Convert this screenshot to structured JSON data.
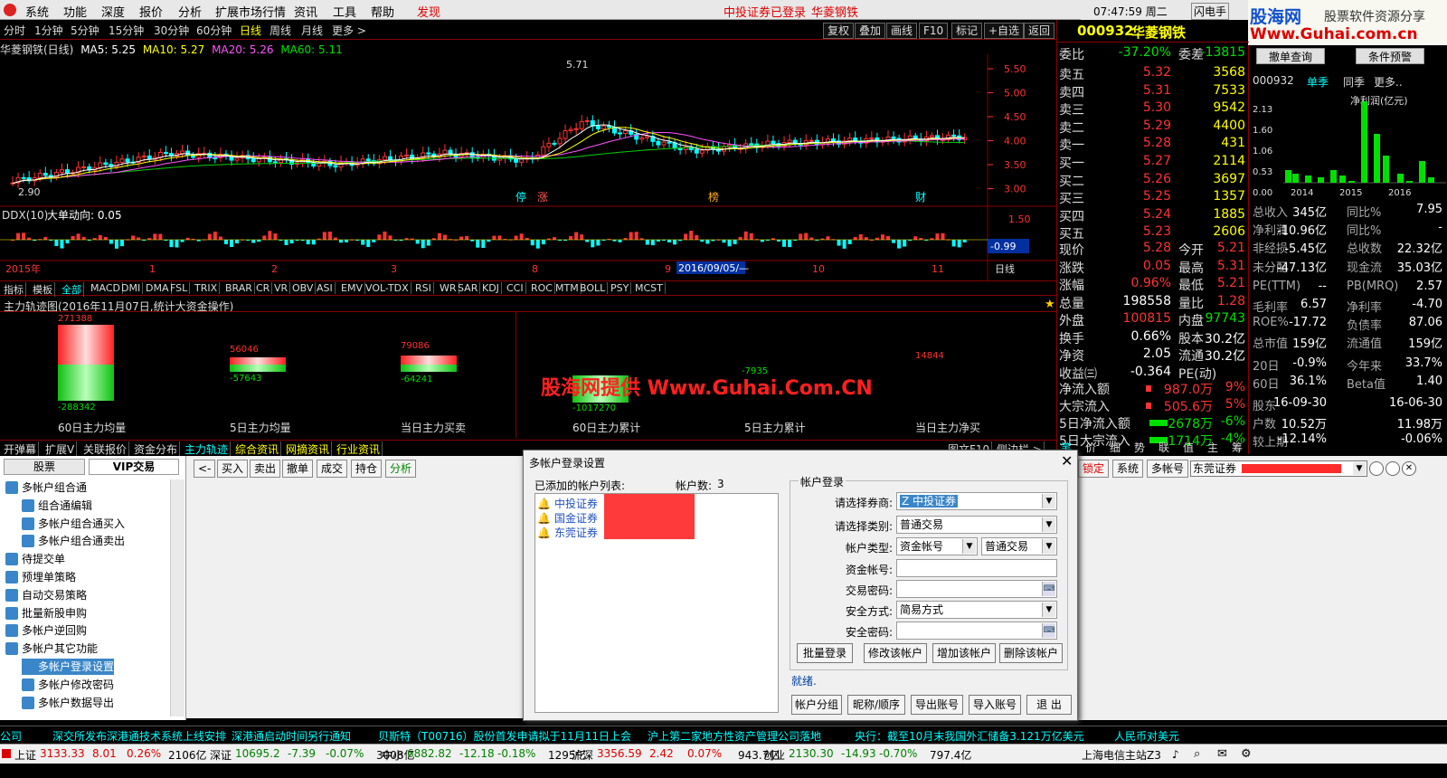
{
  "menu": {
    "items": [
      "系统",
      "功能",
      "深度",
      "报价",
      "分析",
      "扩展市场行情",
      "资讯",
      "工具",
      "帮助",
      "发现"
    ],
    "status_text": "中投证券已登录",
    "stock_link": "华菱钢铁",
    "clock": "07:47:59 周二",
    "shandian": "闪电手"
  },
  "watermark": {
    "top": "股海网",
    "top2": "股票软件资源分享",
    "url": "Www.Guhai.com.cn",
    "center": "股海网提供 Www.Guhai.Com.CN"
  },
  "periods": [
    "分时",
    "1分钟",
    "5分钟",
    "15分钟",
    "30分钟",
    "60分钟",
    "日线",
    "周线",
    "月线",
    "更多 >"
  ],
  "chart_tools": [
    "复权",
    "叠加",
    "画线",
    "F10",
    "标记",
    "+自选",
    "返回"
  ],
  "chart_title": {
    "name": "华菱钢铁(日线)",
    "ma5": "MA5: 5.25",
    "ma10": "MA10: 5.27",
    "ma20": "MA20: 5.26",
    "ma60": "MA60: 5.11"
  },
  "price_axis": [
    "5.50",
    "5.00",
    "4.50",
    "4.00",
    "3.50",
    "3.00"
  ],
  "price_labels": {
    "high": "5.71",
    "low": "2.90"
  },
  "events": [
    "停",
    "涨",
    "榜",
    "财"
  ],
  "ddx": {
    "title": "DDX(10)",
    "desc": "大单动向: 0.05",
    "axis": [
      "1.50"
    ],
    "value": "-0.99"
  },
  "time_axis": {
    "year": "2015年",
    "marks": [
      "1",
      "2",
      "3",
      "8",
      "9",
      "10",
      "11"
    ],
    "cursor": "2016/09/05/—",
    "period": "日线"
  },
  "indicator_tabs": [
    "指标",
    "模板",
    "全部",
    "MACD",
    "DMI",
    "DMA",
    "FSL",
    "TRIX",
    "BRAR",
    "CR",
    "VR",
    "OBV",
    "ASI",
    "EMV",
    "VOL-TDX",
    "RSI",
    "WR",
    "SAR",
    "KDJ",
    "CCI",
    "ROC",
    "MTM",
    "BOLL",
    "PSY",
    "MCST"
  ],
  "main_force": {
    "title": "主力轨迹图(2016年11月07日,统计大资金操作)",
    "items": [
      {
        "label": "60日主力均量",
        "pos": "271388",
        "neg": "-288342"
      },
      {
        "label": "5日主力均量",
        "pos": "56046",
        "neg": "-57643"
      },
      {
        "label": "当日主力买卖",
        "pos": "79086",
        "neg": "-64241"
      },
      {
        "label": "60日主力累计",
        "pos": "-7935",
        "neg": "-1017270"
      },
      {
        "label": "5日主力累计",
        "pos": "",
        "neg": ""
      },
      {
        "label": "当日主力净买",
        "pos": "14844",
        "neg": ""
      }
    ]
  },
  "bottom_tabs": [
    "开弹幕",
    "扩展V",
    "关联报价",
    "资金分布",
    "主力轨迹",
    "综合资讯",
    "网摘资讯",
    "行业资讯",
    "图文F10",
    "侧边栏 >"
  ],
  "quote": {
    "code": "000932",
    "name": "华菱钢铁",
    "weibi": {
      "l": "委比",
      "v": "-37.20%",
      "c": "委差",
      "v2": "-13815"
    },
    "sells": [
      {
        "l": "卖五",
        "p": "5.32",
        "q": "3568"
      },
      {
        "l": "卖四",
        "p": "5.31",
        "q": "7533"
      },
      {
        "l": "卖三",
        "p": "5.30",
        "q": "9542"
      },
      {
        "l": "卖二",
        "p": "5.29",
        "q": "4400"
      },
      {
        "l": "卖一",
        "p": "5.28",
        "q": "431"
      }
    ],
    "buys": [
      {
        "l": "买一",
        "p": "5.27",
        "q": "2114"
      },
      {
        "l": "买二",
        "p": "5.26",
        "q": "3697"
      },
      {
        "l": "买三",
        "p": "5.25",
        "q": "1357"
      },
      {
        "l": "买四",
        "p": "5.24",
        "q": "1885"
      },
      {
        "l": "买五",
        "p": "5.23",
        "q": "2606"
      }
    ],
    "stats": [
      {
        "l": "现价",
        "v": "5.28",
        "c": "今开",
        "v2": "5.21"
      },
      {
        "l": "涨跌",
        "v": "0.05",
        "c": "最高",
        "v2": "5.31"
      },
      {
        "l": "涨幅",
        "v": "0.96%",
        "c": "最低",
        "v2": "5.21"
      },
      {
        "l": "总量",
        "v": "198558",
        "c": "量比",
        "v2": "1.28"
      },
      {
        "l": "外盘",
        "v": "100815",
        "c": "内盘",
        "v2": "97743"
      },
      {
        "l": "换手",
        "v": "0.66%",
        "c": "股本",
        "v2": "30.2亿"
      },
      {
        "l": "净资",
        "v": "2.05",
        "c": "流通",
        "v2": "30.2亿"
      },
      {
        "l": "收益㈢",
        "v": "-0.364",
        "c": "PE(动)",
        "v2": ""
      }
    ],
    "flows": [
      {
        "l": "净流入额",
        "v": "987.0万",
        "p": "9%"
      },
      {
        "l": "大宗流入",
        "v": "505.6万",
        "p": "5%"
      },
      {
        "l": "5日净流入额",
        "v": "-2678万",
        "p": "-6%"
      },
      {
        "l": "5日大宗流入",
        "v": "-1714万",
        "p": "-4%"
      }
    ],
    "side_tabs": [
      "笔",
      "价",
      "细",
      "势",
      "联",
      "值",
      "主",
      "筹"
    ]
  },
  "fin": {
    "buttons": [
      "撤单查询",
      "条件预警"
    ],
    "code": "000932",
    "tabs": [
      "单季",
      "同季",
      "更多.."
    ],
    "chart_title": "净利润(亿元)",
    "chart_data": {
      "type": "bar",
      "yticks": [
        "2.13",
        "1.60",
        "1.06",
        "0.53",
        "0.00"
      ],
      "xticks": [
        "2014",
        "2015",
        "2016"
      ]
    },
    "rows": [
      {
        "a": "总收入",
        "b": "345亿",
        "c": "同比%",
        "d": "7.95"
      },
      {
        "a": "净利润",
        "b": "-10.96亿",
        "c": "同比%",
        "d": "-"
      },
      {
        "a": "非经损",
        "b": "-5.45亿",
        "c": "总收数",
        "d": "22.32亿"
      },
      {
        "a": "未分配",
        "b": "-47.13亿",
        "c": "现金流",
        "d": "35.03亿"
      },
      {
        "a": "PE(TTM)",
        "b": "--",
        "c": "PB(MRQ)",
        "d": "2.57"
      },
      {
        "a": "毛利率",
        "b": "6.57",
        "c": "净利率",
        "d": "-4.70"
      },
      {
        "a": "ROE%",
        "b": "-17.72",
        "c": "负债率",
        "d": "87.06"
      },
      {
        "a": "总市值",
        "b": "159亿",
        "c": "流通值",
        "d": "159亿"
      },
      {
        "a": "20日",
        "b": "-0.9%",
        "c": "今年来",
        "d": "33.7%"
      },
      {
        "a": "60日",
        "b": "36.1%",
        "c": "Beta值",
        "d": "1.40"
      },
      {
        "a": "股东",
        "b": "16-09-30",
        "c": "",
        "d": "16-06-30"
      },
      {
        "a": "户数",
        "b": "10.52万",
        "c": "",
        "d": "11.98万"
      },
      {
        "a": "较上期",
        "b": "-12.14%",
        "c": "",
        "d": "-0.06%"
      }
    ]
  },
  "trade": {
    "tabs": [
      "股票",
      "VIP交易"
    ],
    "toolbar": [
      "<-",
      "买入",
      "卖出",
      "撤单",
      "成交",
      "持仓",
      "分析"
    ],
    "right": [
      "锁定",
      "系统",
      "多帐号"
    ],
    "broker": "东莞证券",
    "tree": [
      {
        "t": "多帐户组合通",
        "lvl": 0
      },
      {
        "t": "组合通编辑",
        "lvl": 1
      },
      {
        "t": "多帐户组合通买入",
        "lvl": 1
      },
      {
        "t": "多帐户组合通卖出",
        "lvl": 1
      },
      {
        "t": "待提交单",
        "lvl": 0
      },
      {
        "t": "预埋单策略",
        "lvl": 0
      },
      {
        "t": "自动交易策略",
        "lvl": 0
      },
      {
        "t": "批量新股申购",
        "lvl": 0
      },
      {
        "t": "多帐户逆回购",
        "lvl": 0
      },
      {
        "t": "多帐户其它功能",
        "lvl": 0
      },
      {
        "t": "多帐户登录设置",
        "lvl": 1
      },
      {
        "t": "多帐户修改密码",
        "lvl": 1
      },
      {
        "t": "多帐户数据导出",
        "lvl": 1
      }
    ]
  },
  "dialog": {
    "title": "多帐户登录设置",
    "list_label": "已添加的帐户列表:",
    "count_label": "帐户数:",
    "count": "3",
    "accounts": [
      "中投证券",
      "国金证券",
      "东莞证券"
    ],
    "group_label": "帐户登录",
    "fields": [
      {
        "label": "请选择券商:",
        "value": "Z 中投证券"
      },
      {
        "label": "请选择类别:",
        "value": "普通交易"
      },
      {
        "label": "帐户类型:",
        "value": "资金帐号",
        "value2": "普通交易"
      },
      {
        "label": "资金帐号:",
        "value": ""
      },
      {
        "label": "交易密码:",
        "value": ""
      },
      {
        "label": "安全方式:",
        "value": "简易方式"
      },
      {
        "label": "安全密码:",
        "value": ""
      }
    ],
    "buttons": [
      "批量登录",
      "修改该帐户",
      "增加该帐户",
      "删除该帐户"
    ],
    "status": "就绪.",
    "bottom_buttons": [
      "帐户分组",
      "昵称/顺序",
      "导出账号",
      "导入账号",
      "退 出"
    ]
  },
  "ticker": [
    "公司",
    "深交所发布深港通技术系统上线安排",
    "深港通启动时间另行通知",
    "贝斯特（T00716）股份首发申请拟于11月11日上会",
    "沪上第二家地方性资产管理公司落地",
    "央行：截至10月末我国外汇储备3.121万亿美元",
    "人民币对美元"
  ],
  "indices": [
    {
      "n": "上证",
      "v": "3133.33",
      "c": "8.01",
      "p": "0.26%",
      "a": "2106亿"
    },
    {
      "n": "深证",
      "v": "10695.2",
      "c": "-7.39",
      "p": "-0.07%",
      "a": "3008亿"
    },
    {
      "n": "中小",
      "v": "6882.82",
      "c": "-12.18",
      "p": "-0.18%",
      "a": "1295亿"
    },
    {
      "n": "沪深",
      "v": "3356.59",
      "c": "2.42",
      "p": "0.07%",
      "a": "943.7亿"
    },
    {
      "n": "创业",
      "v": "2130.30",
      "c": "-14.93",
      "p": "-0.70%",
      "a": "797.4亿"
    }
  ],
  "server": "上海电信主站Z3"
}
